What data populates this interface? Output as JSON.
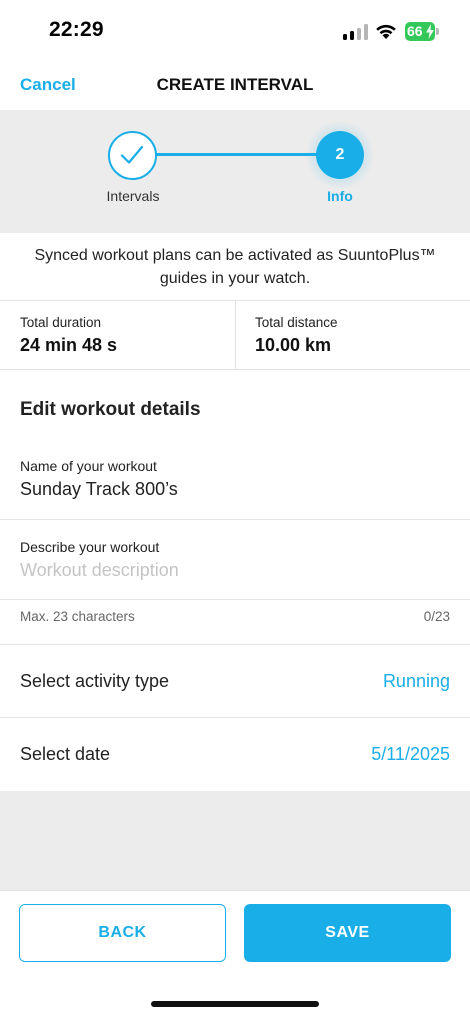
{
  "status_bar": {
    "time": "22:29",
    "battery": "66"
  },
  "nav": {
    "cancel_label": "Cancel",
    "title": "CREATE INTERVAL"
  },
  "stepper": {
    "step1_label": "Intervals",
    "step2_number": "2",
    "step2_label": "Info",
    "accent_color": "#1aaee8"
  },
  "info_text": "Synced workout plans can be activated as SuuntoPlus™ guides in your watch.",
  "stats": {
    "duration_label": "Total duration",
    "duration_value": "24 min 48 s",
    "distance_label": "Total distance",
    "distance_value": "10.00 km"
  },
  "details": {
    "heading": "Edit workout details",
    "name_label": "Name of your workout",
    "name_value": "Sunday Track 800’s",
    "description_label": "Describe your workout",
    "description_placeholder": "Workout description",
    "max_hint": "Max. 23 characters",
    "char_count": "0/23"
  },
  "activity": {
    "label": "Select activity type",
    "value": "Running"
  },
  "date": {
    "label": "Select date",
    "value": "5/11/2025"
  },
  "buttons": {
    "back_label": "BACK",
    "save_label": "SAVE"
  }
}
